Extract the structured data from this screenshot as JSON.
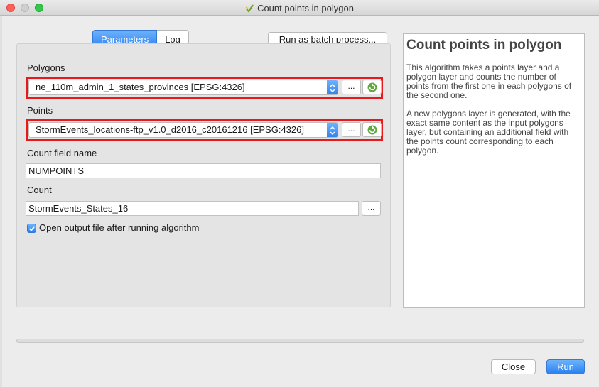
{
  "window": {
    "title": "Count points in polygon",
    "accent_color": "#2980f1",
    "highlight_color": "#e8191b"
  },
  "tabs": [
    {
      "label": "Parameters",
      "active": true
    },
    {
      "label": "Log",
      "active": false
    }
  ],
  "batch_button": "Run as batch process...",
  "params": {
    "polygons": {
      "label": "Polygons",
      "value": "ne_110m_admin_1_states_provinces [EPSG:4326]",
      "browse_label": "..."
    },
    "points": {
      "label": "Points",
      "value": "StormEvents_locations-ftp_v1.0_d2016_c20161216 [EPSG:4326]",
      "browse_label": "..."
    },
    "count_field": {
      "label": "Count field name",
      "value": "NUMPOINTS"
    },
    "count": {
      "label": "Count",
      "value": "StormEvents_States_16",
      "browse_label": "..."
    },
    "open_output": {
      "label": "Open output file after running algorithm",
      "checked": true
    }
  },
  "help": {
    "title": "Count points in polygon",
    "paragraphs": [
      "This algorithm takes a points layer and a polygon layer and counts the number of points from the first one in each polygons of the second one.",
      "A new polygons layer is generated, with the exact same content as the input polygons layer, but containing an additional field with the points count corresponding to each polygon."
    ]
  },
  "footer": {
    "close_label": "Close",
    "run_label": "Run"
  }
}
